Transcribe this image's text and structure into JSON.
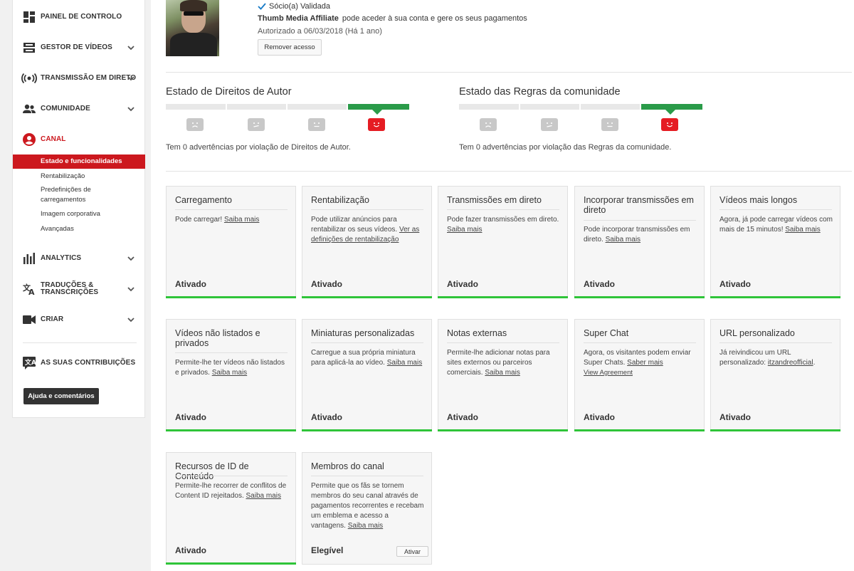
{
  "sidebar": {
    "items": [
      {
        "label": "PAINEL DE CONTROLO",
        "icon": "dashboard-icon"
      },
      {
        "label": "GESTOR DE VÍDEOS",
        "icon": "video-manager-icon"
      },
      {
        "label": "TRANSMISSÃO EM DIRETO",
        "icon": "live-stream-icon"
      },
      {
        "label": "COMUNIDADE",
        "icon": "community-icon"
      },
      {
        "label": "CANAL",
        "icon": "channel-icon"
      },
      {
        "label": "ANALYTICS",
        "icon": "analytics-icon"
      },
      {
        "label": "TRADUÇÕES &",
        "label2": "TRANSCRIÇÕES",
        "icon": "translate-icon"
      },
      {
        "label": "CRIAR",
        "icon": "create-icon"
      }
    ],
    "channel_subitems": [
      "Estado e funcionalidades",
      "Rentabilização",
      "Predefinições de",
      "carregamentos",
      "Imagem corporativa",
      "Avançadas"
    ],
    "contributions": "AS SUAS CONTRIBUIÇÕES",
    "help_button": "Ajuda e comentários",
    "accent_color": "#cc181e"
  },
  "partner": {
    "status": "Sócio(a) Validada",
    "affiliate_name": "Thumb Media Affiliate",
    "affiliate_text": "pode aceder à sua conta e gere os seus pagamentos",
    "authorized": "Autorizado a 06/03/2018 (Há 1 ano)",
    "remove_button": "Remover acesso"
  },
  "copyright": {
    "title": "Estado de Direitos de Autor",
    "message": "Tem 0 advertências por violação de Direitos de Autor."
  },
  "community": {
    "title": "Estado das Regras da comunidade",
    "message": "Tem 0 advertências por violação das Regras da comunidade."
  },
  "features": [
    {
      "title": "Carregamento",
      "desc": "Pode carregar! ",
      "link": "Saiba mais",
      "status": "Ativado"
    },
    {
      "title": "Rentabilização",
      "desc": "Pode utilizar anúncios para rentabilizar os seus vídeos. ",
      "link": "Ver as definições de rentabilização",
      "status": "Ativado"
    },
    {
      "title": "Transmissões em direto",
      "desc": "Pode fazer transmissões em direto. ",
      "link": "Saiba mais",
      "status": "Ativado"
    },
    {
      "title": "Incorporar transmissões em direto",
      "desc": "Pode incorporar transmissões em direto. ",
      "link": "Saiba mais",
      "status": "Ativado"
    },
    {
      "title": "Vídeos mais longos",
      "desc": "Agora, já pode carregar vídeos com mais de 15 minutos! ",
      "link": "Saiba mais",
      "status": "Ativado"
    },
    {
      "title": "Vídeos não listados e privados",
      "desc": "Permite-lhe ter vídeos não listados e privados. ",
      "link": "Saiba mais",
      "status": "Ativado"
    },
    {
      "title": "Miniaturas personalizadas",
      "desc": "Carregue a sua própria miniatura para aplicá-la ao vídeo. ",
      "link": "Saiba mais",
      "status": "Ativado"
    },
    {
      "title": "Notas externas",
      "desc": "Permite-lhe adicionar notas para sites externos ou parceiros comerciais. ",
      "link": "Saiba mais",
      "status": "Ativado"
    },
    {
      "title": "Super Chat",
      "desc": "Agora, os visitantes podem enviar Super Chats. ",
      "link": "Saber mais",
      "extra_link": "View Agreement",
      "status": "Ativado"
    },
    {
      "title": "URL personalizado",
      "desc": "Já reivindicou um URL personalizado: ",
      "link": "itzandreofficial",
      "desc_end": ".",
      "status": "Ativado"
    },
    {
      "title": "Recursos de ID de Conteúdo",
      "desc": "Permite-lhe recorrer de conflitos de Content ID rejeitados. ",
      "link": "Saiba mais",
      "status": "Ativado"
    },
    {
      "title": "Membros do canal",
      "desc": "Permite que os fãs se tornem membros do seu canal através de pagamentos recorrentes e recebam um emblema e acesso a vantagens. ",
      "link": "Saiba mais",
      "status": "Elegível",
      "button": "Ativar"
    }
  ]
}
